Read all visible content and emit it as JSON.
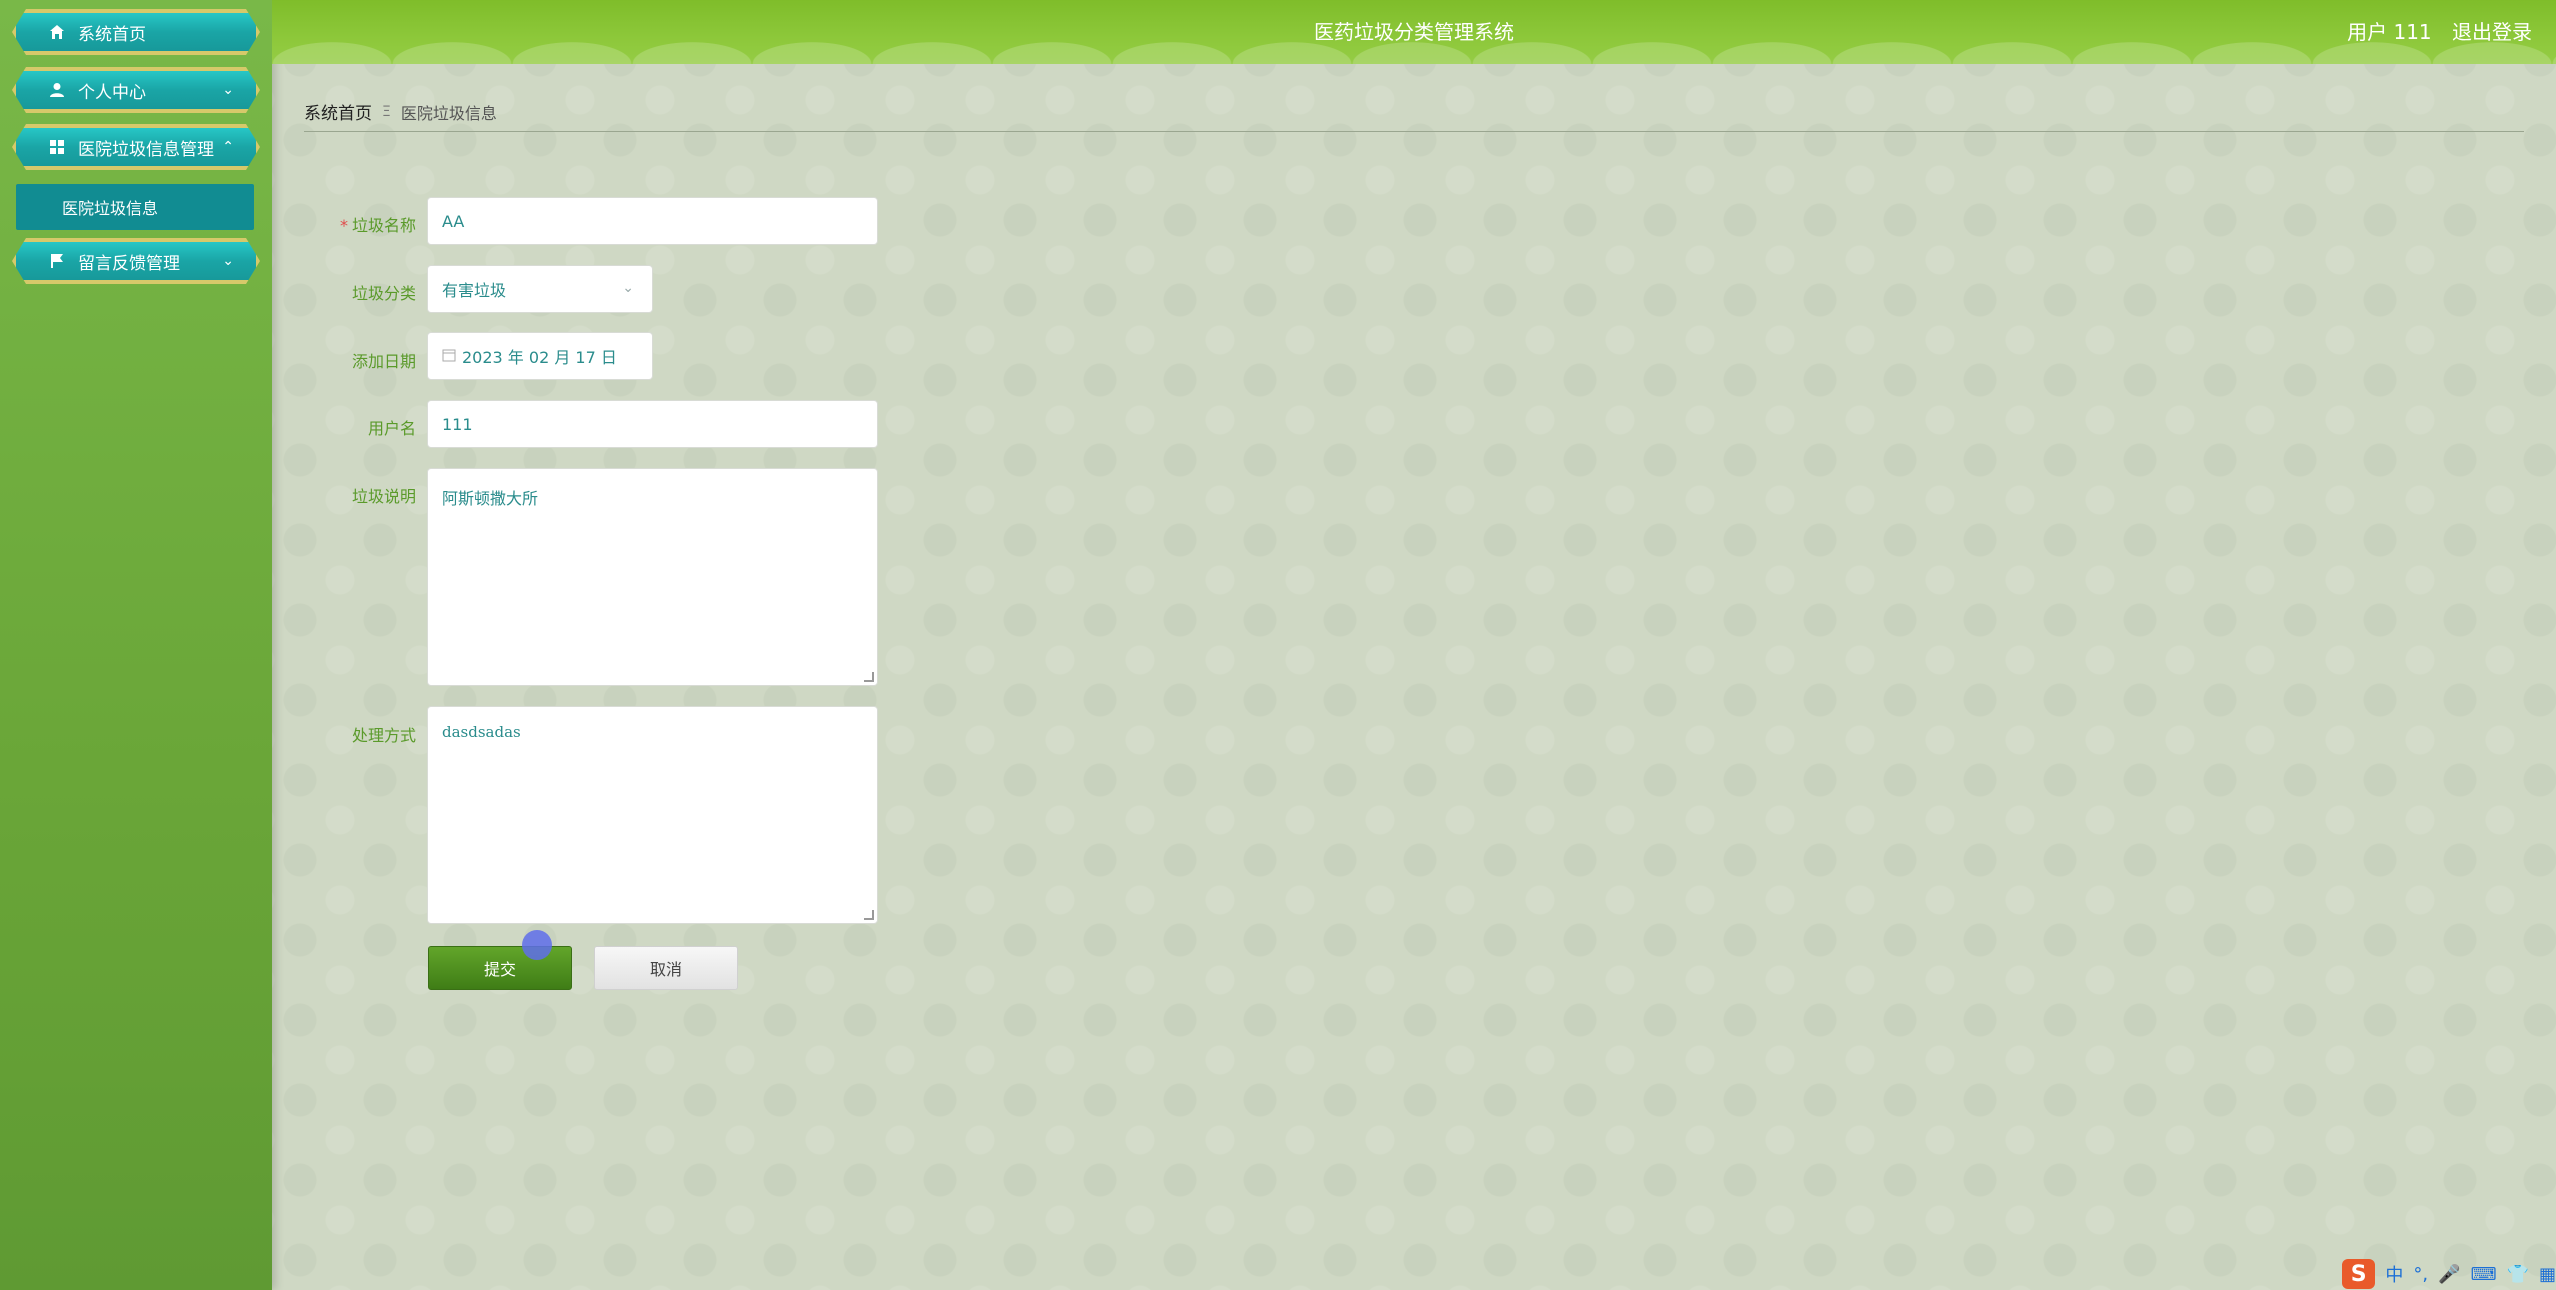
{
  "sidebar": {
    "items": [
      {
        "label": "系统首页",
        "icon": "home-icon"
      },
      {
        "label": "个人中心",
        "icon": "user-icon"
      },
      {
        "label": "医院垃圾信息管理",
        "icon": "grid-icon"
      },
      {
        "label": "留言反馈管理",
        "icon": "flag-icon"
      }
    ],
    "submenu": {
      "label": "医院垃圾信息"
    }
  },
  "header": {
    "title": "医药垃圾分类管理系统",
    "user_label": "用户 111",
    "logout_label": "退出登录"
  },
  "breadcrumb": {
    "home": "系统首页",
    "separator": "Ξ",
    "current": "医院垃圾信息"
  },
  "form": {
    "name_label": "垃圾名称",
    "name_value": "AA",
    "category_label": "垃圾分类",
    "category_value": "有害垃圾",
    "date_label": "添加日期",
    "date_value": "2023 年 02 月 17 日",
    "username_label": "用户名",
    "username_value": "111",
    "desc_label": "垃圾说明",
    "desc_value": "阿斯顿撒大所",
    "method_label": "处理方式",
    "method_value": "dasdsadas",
    "submit_label": "提交",
    "cancel_label": "取消"
  },
  "ime": {
    "logo": "S",
    "items": [
      "中",
      "°,",
      "🎤",
      "⌨",
      "👕",
      "▦"
    ]
  },
  "colors": {
    "header": "#85c22f",
    "sidebar": "#6aa638",
    "menu": "#1aa5a6",
    "accent_text": "#2a8c8c",
    "submit": "#4e8f1f"
  }
}
